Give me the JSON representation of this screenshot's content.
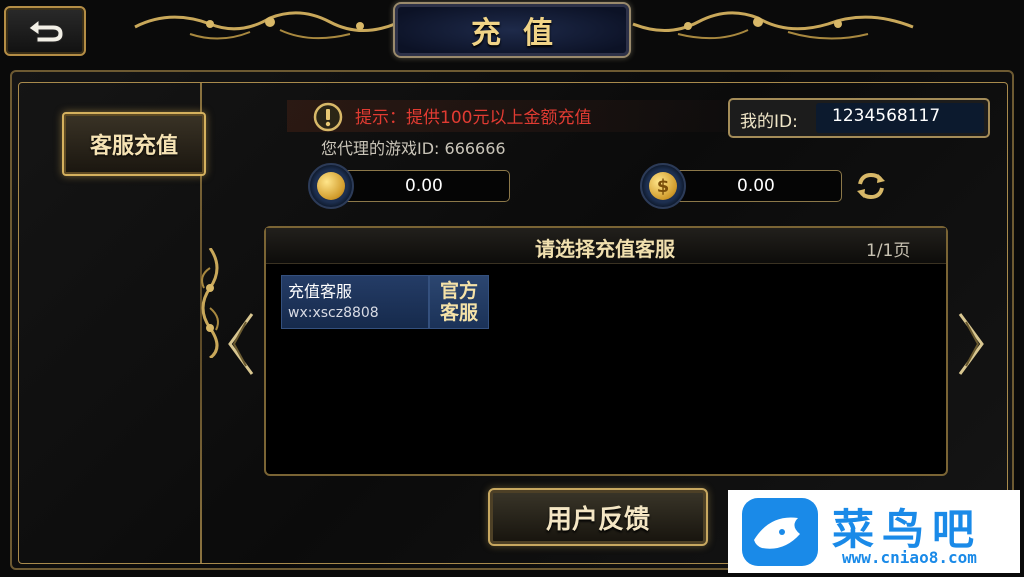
{
  "header": {
    "title": "充值"
  },
  "sidebar": {
    "tabs": [
      {
        "label": "客服充值",
        "selected": true
      }
    ]
  },
  "notice": {
    "text": "提示：提供100元以上金额充值",
    "agent_id_text": "您代理的游戏ID: 666666"
  },
  "account": {
    "id_label": "我的ID:",
    "id_value": "1234568117"
  },
  "balances": {
    "gold": "0.00",
    "cash": "0.00",
    "cash_symbol": "$"
  },
  "service_list": {
    "title": "请选择充值客服",
    "page": "1/1页",
    "items": [
      {
        "name": "充值客服",
        "wx": "wx:xscz8808",
        "badge_line1": "官方",
        "badge_line2": "客服"
      }
    ]
  },
  "footer": {
    "feedback_label": "用户反馈"
  },
  "watermark": {
    "name": "菜鸟吧",
    "url": "www.cniao8.com"
  },
  "colors": {
    "gold": "#d5b15e",
    "notice_red": "#e13b32",
    "card_blue": "#243c66",
    "watermark_blue": "#1a8ae8"
  },
  "icons": [
    "back-arrow-icon",
    "warning-icon",
    "gold-coin-icon",
    "dollar-coin-icon",
    "refresh-icon",
    "chevron-left-icon",
    "chevron-right-icon",
    "bird-logo-icon"
  ]
}
